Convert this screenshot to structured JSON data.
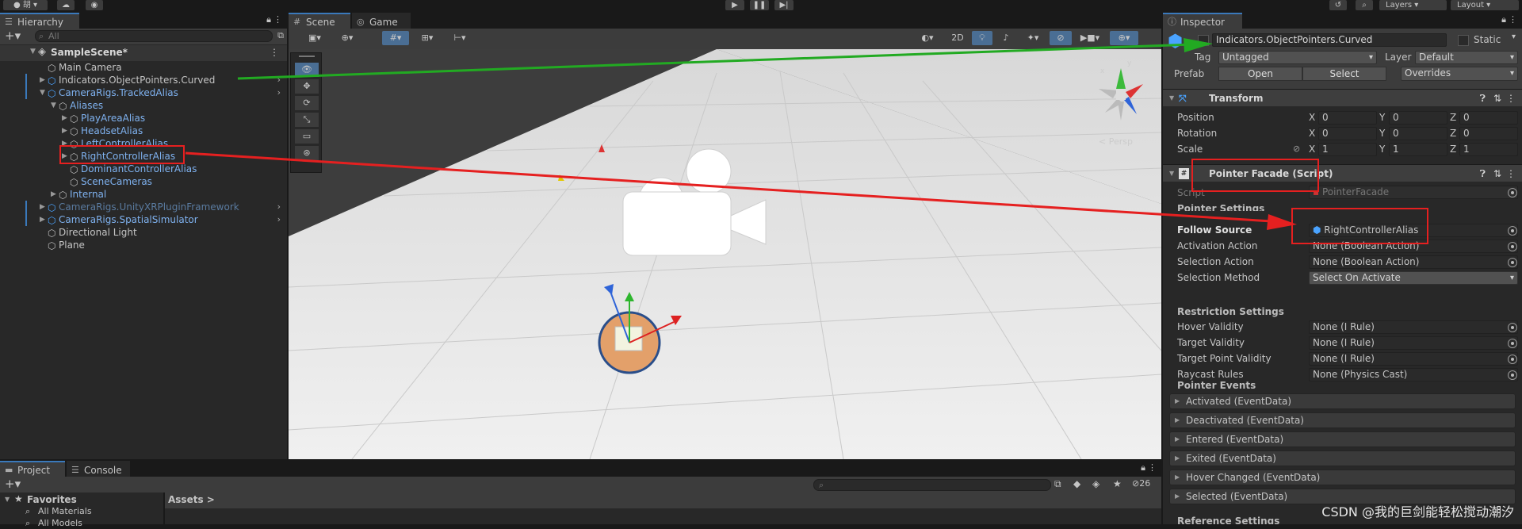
{
  "toolbar": {
    "account_label": "胡",
    "layers_label": "Layers",
    "layout_label": "Layout"
  },
  "hierarchy": {
    "tab_label": "Hierarchy",
    "search_placeholder": "All",
    "scene_name": "SampleScene*",
    "items": [
      {
        "label": "Main Camera"
      },
      {
        "label": "Indicators.ObjectPointers.Curved"
      },
      {
        "label": "CameraRigs.TrackedAlias"
      },
      {
        "label": "Aliases"
      },
      {
        "label": "PlayAreaAlias"
      },
      {
        "label": "HeadsetAlias"
      },
      {
        "label": "LeftControllerAlias"
      },
      {
        "label": "RightControllerAlias"
      },
      {
        "label": "DominantControllerAlias"
      },
      {
        "label": "SceneCameras"
      },
      {
        "label": "Internal"
      },
      {
        "label": "CameraRigs.UnityXRPluginFramework"
      },
      {
        "label": "CameraRigs.SpatialSimulator"
      },
      {
        "label": "Directional Light"
      },
      {
        "label": "Plane"
      }
    ]
  },
  "scene": {
    "tab_scene": "Scene",
    "tab_game": "Game",
    "btn_2d": "2D",
    "persp_label": "< Persp"
  },
  "inspector": {
    "tab_label": "Inspector",
    "object_name": "Indicators.ObjectPointers.Curved",
    "static_label": "Static",
    "tag_label": "Tag",
    "tag_value": "Untagged",
    "layer_label": "Layer",
    "layer_value": "Default",
    "prefab_label": "Prefab",
    "open_label": "Open",
    "select_label": "Select",
    "overrides_label": "Overrides",
    "transform": {
      "title": "Transform",
      "position_label": "Position",
      "rotation_label": "Rotation",
      "scale_label": "Scale",
      "position": [
        "0",
        "0",
        "0"
      ],
      "rotation": [
        "0",
        "0",
        "0"
      ],
      "scale": [
        "1",
        "1",
        "1"
      ],
      "x": "X",
      "y": "Y",
      "z": "Z"
    },
    "pointer": {
      "title": "Pointer Facade (Script)",
      "script_label": "Script",
      "script_value": "PointerFacade",
      "section_label": "Pointer Settings",
      "follow_source_label": "Follow Source",
      "follow_source_value": "RightControllerAlias",
      "activation_label": "Activation Action",
      "activation_value": "None (Boolean Action)",
      "selection_action_label": "Selection Action",
      "selection_action_value": "None (Boolean Action)",
      "selection_method_label": "Selection Method",
      "selection_method_value": "Select On Activate",
      "restriction_label": "Restriction Settings",
      "hover_validity_label": "Hover Validity",
      "hover_validity_value": "None (I Rule)",
      "target_validity_label": "Target Validity",
      "target_validity_value": "None (I Rule)",
      "target_point_label": "Target Point Validity",
      "target_point_value": "None (I Rule)",
      "raycast_label": "Raycast Rules",
      "raycast_value": "None (Physics Cast)",
      "events_label": "Pointer Events",
      "events": [
        "Activated (EventData)",
        "Deactivated (EventData)",
        "Entered (EventData)",
        "Exited (EventData)",
        "Hover Changed (EventData)",
        "Selected (EventData)"
      ],
      "reference_label": "Reference Settings"
    }
  },
  "project": {
    "tab_project": "Project",
    "tab_console": "Console",
    "favorites_label": "Favorites",
    "all_materials": "All Materials",
    "all_models": "All Models",
    "assets_label": "Assets >",
    "count_label": "26"
  },
  "watermark": "CSDN @我的巨剑能轻松搅动潮汐",
  "colors": {
    "accent": "#3a79bb",
    "annotation_red": "#e52020",
    "annotation_green": "#22aa22",
    "scene_floor": "#e9e9e9",
    "scene_sky": "#3d3d3d"
  }
}
